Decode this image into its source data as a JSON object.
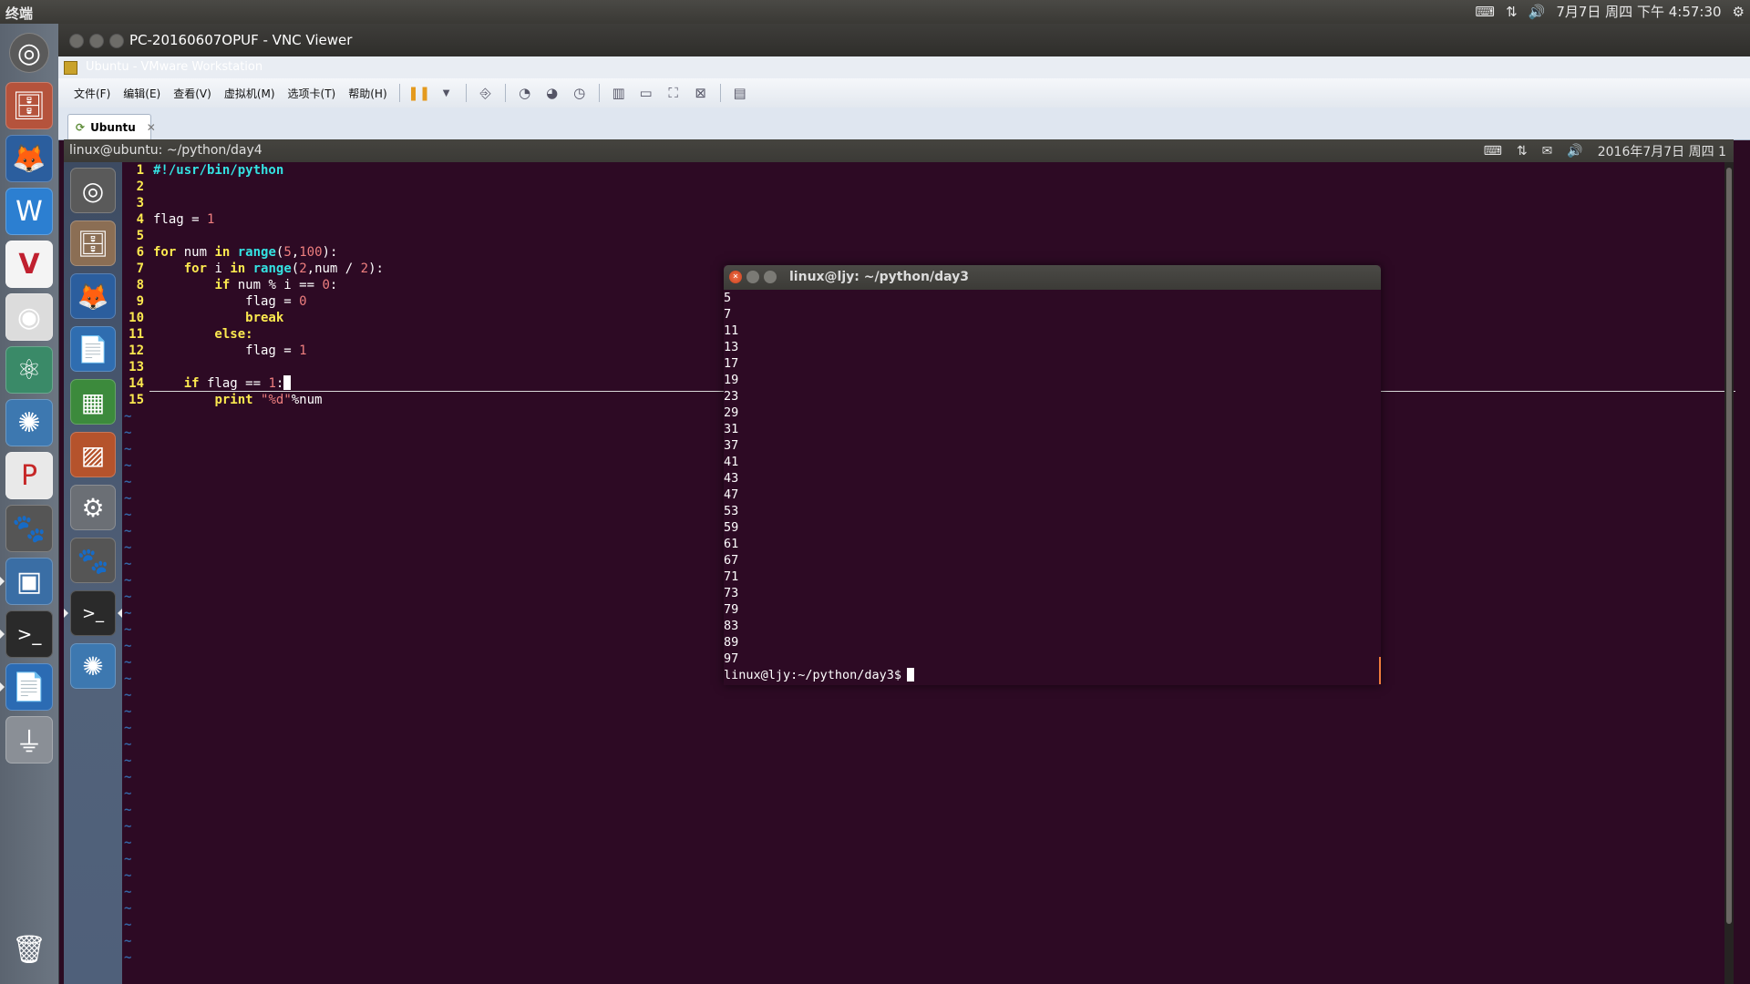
{
  "host_panel": {
    "title": "终端",
    "indicators": {
      "keyboard": "⌨",
      "network": "⇅",
      "volume": "🔊",
      "datetime": "7月7日 周四 下午 4:57:30",
      "settings": "⚙"
    }
  },
  "host_launcher": {
    "items": [
      "dash",
      "files",
      "firefox",
      "wps-writer",
      "vscode",
      "chrome",
      "atom",
      "shotwell",
      "wps-presentation",
      "gimp",
      "virtualbox",
      "terminal",
      "libreoffice-writer",
      "usb-drive",
      "trash"
    ]
  },
  "vnc": {
    "title": "PC-20160607OPUF - VNC Viewer"
  },
  "vmware": {
    "title": "Ubuntu - VMware Workstation",
    "menus": [
      "文件(F)",
      "编辑(E)",
      "查看(V)",
      "虚拟机(M)",
      "选项卡(T)",
      "帮助(H)"
    ],
    "tab_label": "Ubuntu"
  },
  "guest_panel": {
    "title": "linux@ubuntu: ~/python/day4",
    "datetime": "2016年7月7日 周四 1"
  },
  "vim": {
    "lines": [
      {
        "n": "1",
        "text": "#!/usr/bin/python"
      },
      {
        "n": "2",
        "text": ""
      },
      {
        "n": "3",
        "text": ""
      },
      {
        "n": "4",
        "text": "flag = 1"
      },
      {
        "n": "5",
        "text": ""
      },
      {
        "n": "6",
        "text": "for num in range(5,100):"
      },
      {
        "n": "7",
        "text": "    for i in range(2,num / 2):"
      },
      {
        "n": "8",
        "text": "        if num % i == 0:"
      },
      {
        "n": "9",
        "text": "            flag = 0"
      },
      {
        "n": "10",
        "text": "            break"
      },
      {
        "n": "11",
        "text": "        else:"
      },
      {
        "n": "12",
        "text": "            flag = 1"
      },
      {
        "n": "13",
        "text": ""
      },
      {
        "n": "14",
        "text": "    if flag == 1:"
      },
      {
        "n": "15",
        "text": "        print \"%d\"%num"
      }
    ],
    "tilde": "~"
  },
  "terminal": {
    "title": "linux@ljy: ~/python/day3",
    "output": [
      "5",
      "7",
      "11",
      "13",
      "17",
      "19",
      "23",
      "29",
      "31",
      "37",
      "41",
      "43",
      "47",
      "53",
      "59",
      "61",
      "67",
      "71",
      "73",
      "79",
      "83",
      "89",
      "97"
    ],
    "prompt": "linux@ljy:~/python/day3$"
  }
}
